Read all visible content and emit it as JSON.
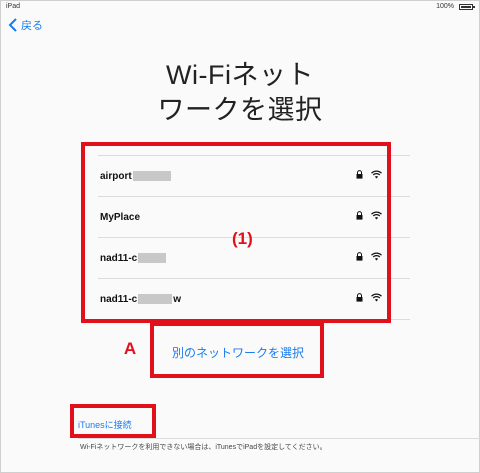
{
  "status_bar": {
    "device": "iPad",
    "battery": "100%"
  },
  "nav": {
    "back_label": "戻る"
  },
  "title": {
    "line1": "Wi-Fiネット",
    "line2": "ワークを選択"
  },
  "networks": [
    {
      "name": "airport",
      "locked": true,
      "icon": "wifi-icon"
    },
    {
      "name": "MyPlace",
      "locked": true,
      "icon": "wifi-icon"
    },
    {
      "name": "nad11-c",
      "locked": true,
      "icon": "wifi-icon"
    },
    {
      "name": "nad11-c",
      "suffix": "w",
      "locked": true,
      "icon": "wifi-icon"
    }
  ],
  "other_network_label": "別のネットワークを選択",
  "itunes": {
    "link_label": "iTunesに接続",
    "note": "Wi-Fiネットワークを利用できない場合は、iTunesでiPadを設定してください。"
  },
  "annotations": {
    "list_marker": "(1)",
    "other_marker": "A"
  },
  "colors": {
    "accent": "#1a7cf0",
    "annotation": "#e0111b"
  }
}
